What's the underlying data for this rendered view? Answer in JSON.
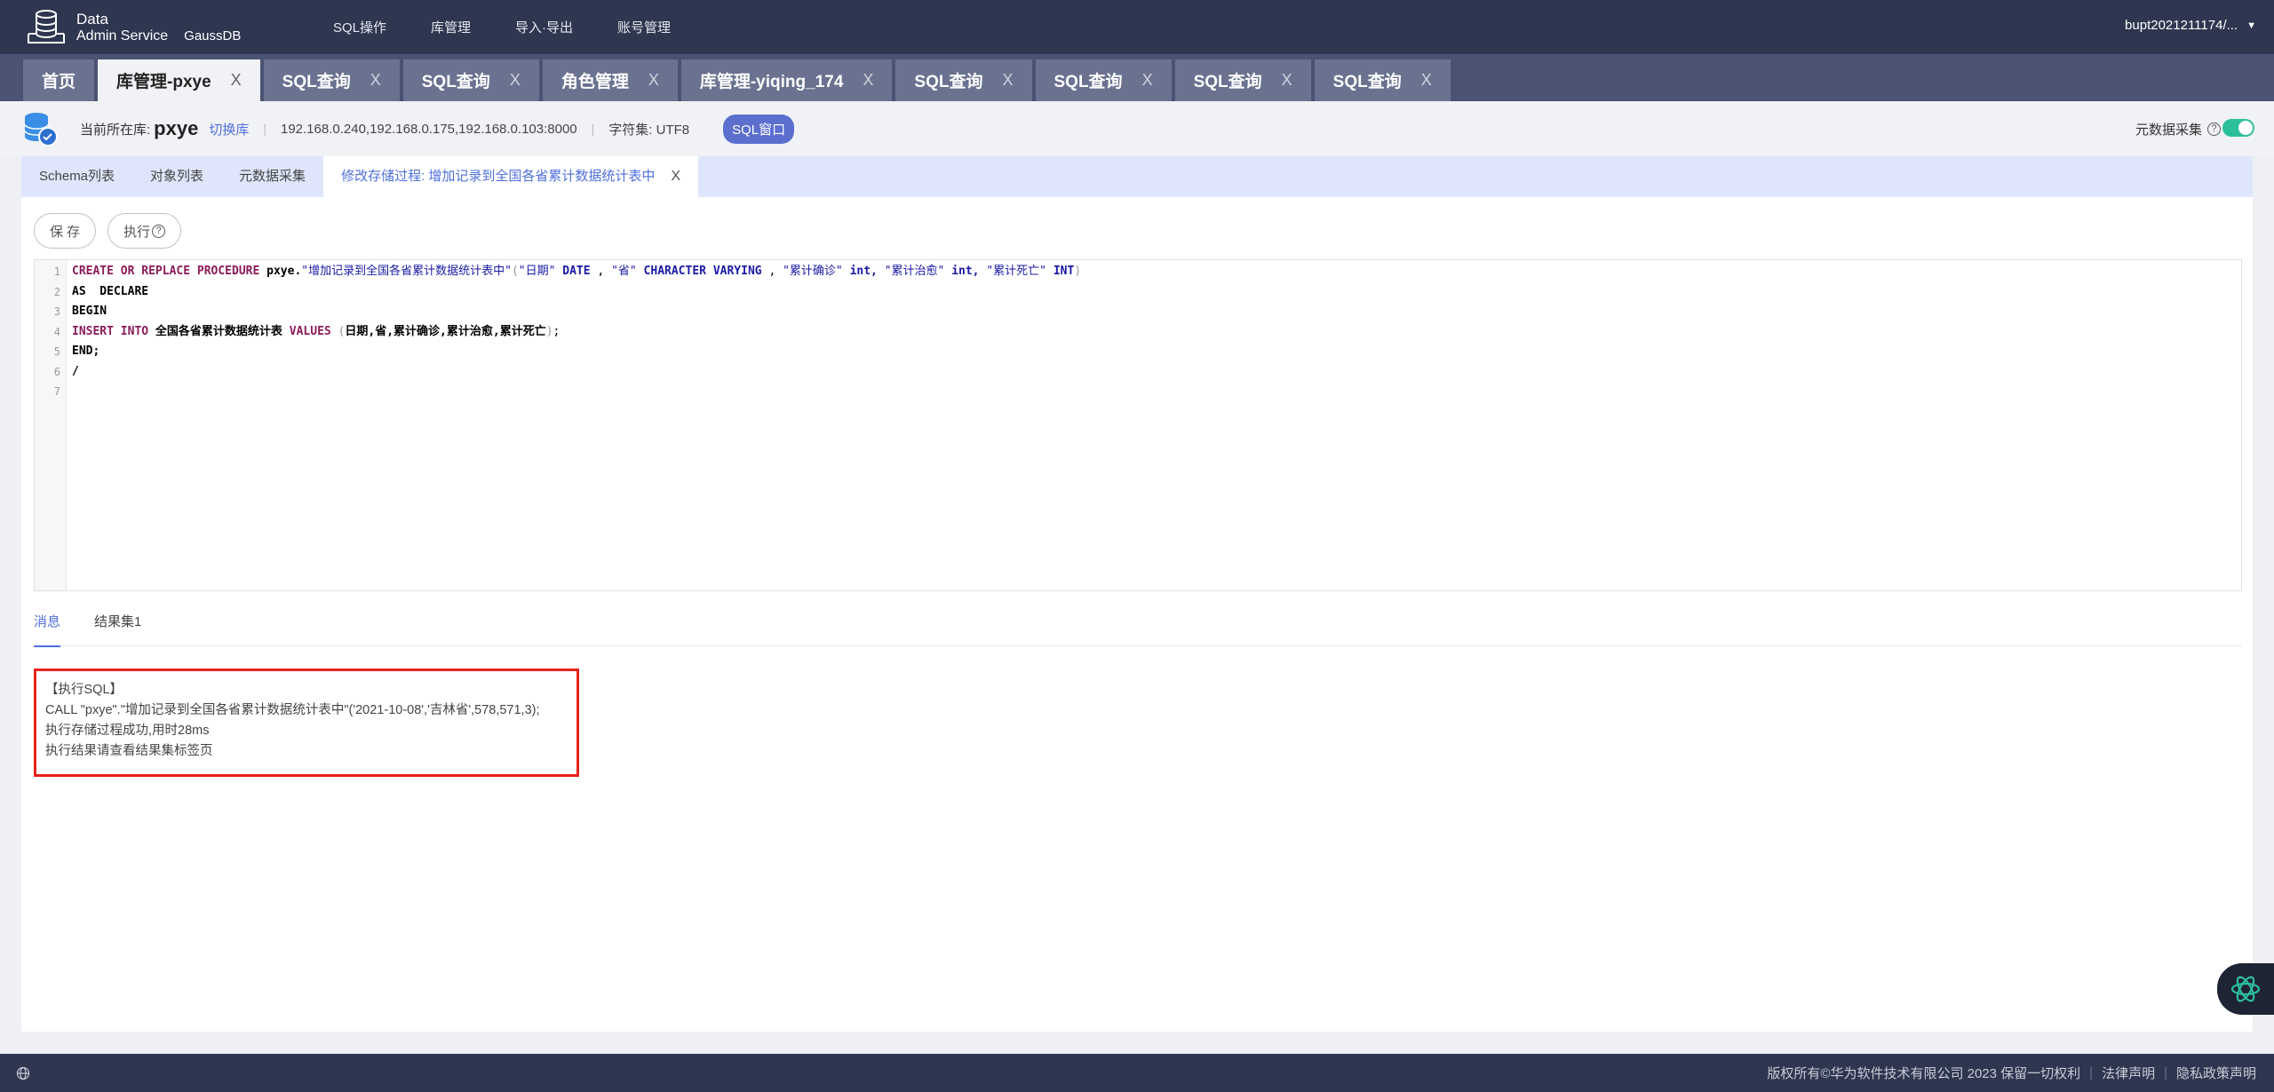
{
  "header": {
    "logo_line1": "Data",
    "logo_line2": "Admin Service",
    "logo_product": "GaussDB",
    "nav": [
      "SQL操作",
      "库管理",
      "导入·导出",
      "账号管理"
    ],
    "user": "bupt2021211174/..."
  },
  "tabs": [
    {
      "label": "首页",
      "closable": false
    },
    {
      "label": "库管理-pxye",
      "closable": true,
      "active": true
    },
    {
      "label": "SQL查询",
      "closable": true
    },
    {
      "label": "SQL查询",
      "closable": true
    },
    {
      "label": "角色管理",
      "closable": true
    },
    {
      "label": "库管理-yiqing_174",
      "closable": true
    },
    {
      "label": "SQL查询",
      "closable": true
    },
    {
      "label": "SQL查询",
      "closable": true
    },
    {
      "label": "SQL查询",
      "closable": true
    },
    {
      "label": "SQL查询",
      "closable": true
    }
  ],
  "close_glyph": "X",
  "infobar": {
    "current_label": "当前所在库:",
    "current_db": "pxye",
    "switch_label": "切换库",
    "hosts": "192.168.0.240,192.168.0.175,192.168.0.103:8000",
    "charset": "字符集: UTF8",
    "sql_window": "SQL窗口",
    "meta_collect": "元数据采集",
    "meta_toggle_on": true
  },
  "subtabs": {
    "items": [
      "Schema列表",
      "对象列表",
      "元数据采集"
    ],
    "active": "修改存储过程: 增加记录到全国各省累计数据统计表中"
  },
  "actions": {
    "save": "保 存",
    "execute": "执行"
  },
  "editor": {
    "line_numbers": [
      "1",
      "2",
      "3",
      "4",
      "5",
      "6",
      "7"
    ],
    "l1": {
      "create": "CREATE OR REPLACE PROCEDURE",
      "schema": "pxye.",
      "name": "\"增加记录到全国各省累计数据统计表中\"",
      "p_open": "(",
      "a1": "\"日期\"",
      "t1": "DATE",
      "c1": ",",
      "a2": "\"省\"",
      "t2": "CHARACTER VARYING",
      "c2": ",",
      "a3": "\"累计确诊\"",
      "t3": "int,",
      "a4": "\"累计治愈\"",
      "t4": "int,",
      "a5": "\"累计死亡\"",
      "t5": "INT",
      "p_close": ")"
    },
    "l2": "AS  DECLARE",
    "l3": "BEGIN",
    "l4": {
      "kw": "INSERT INTO",
      "table": "全国各省累计数据统计表",
      "values": "VALUES",
      "p_open": "(",
      "cols": "日期,省,累计确诊,累计治愈,累计死亡",
      "p_close": ")",
      "end": ";"
    },
    "l5": "END;",
    "l6": "/",
    "l7": ""
  },
  "result": {
    "tabs": [
      "消息",
      "结果集1"
    ],
    "messages": [
      "【执行SQL】",
      "CALL \"pxye\".\"增加记录到全国各省累计数据统计表中\"('2021-10-08','吉林省',578,571,3);",
      "执行存储过程成功,用时28ms",
      "执行结果请查看结果集标签页"
    ]
  },
  "footer": {
    "copyright": "版权所有©华为软件技术有限公司 2023 保留一切权利",
    "legal": "法律声明",
    "privacy": "隐私政策声明"
  },
  "colors": {
    "header_bg": "#2f3650",
    "accent": "#4f6fdc",
    "highlight_border": "#e8201c",
    "toggle_on": "#2dbf9b"
  }
}
